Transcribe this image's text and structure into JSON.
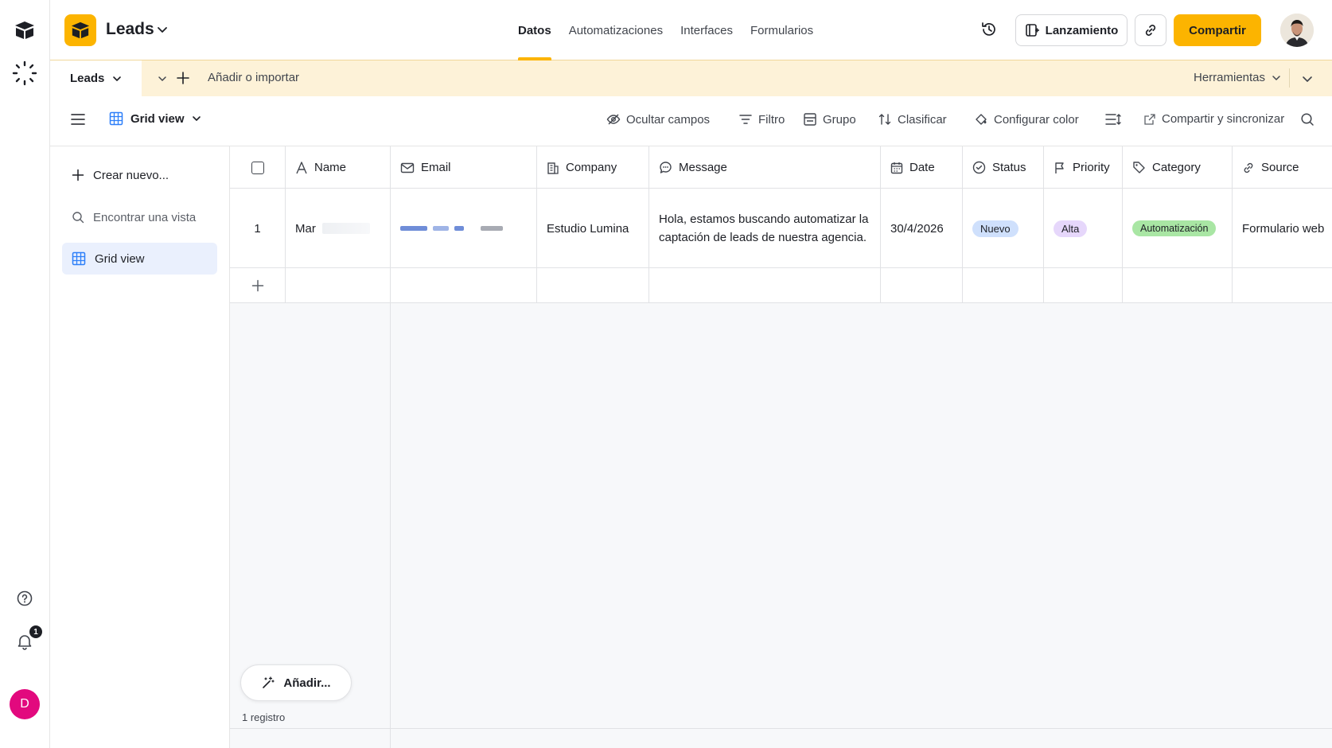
{
  "app": {
    "base_name": "Leads",
    "nav_tabs": [
      "Datos",
      "Automatizaciones",
      "Interfaces",
      "Formularios"
    ],
    "active_nav_tab": "Datos",
    "launch_label": "Lanzamiento",
    "share_label": "Compartir",
    "brand_color": "#fcb400"
  },
  "rail": {
    "user_initial": "D",
    "notification_count": "1",
    "avatar_color": "#e2097e"
  },
  "tables": {
    "active_table": "Leads",
    "add_import_label": "Añadir o importar",
    "tools_label": "Herramientas"
  },
  "viewbar": {
    "view_name": "Grid view",
    "hide_fields": "Ocultar campos",
    "filter": "Filtro",
    "group": "Grupo",
    "sort": "Clasificar",
    "color": "Configurar color",
    "share_sync": "Compartir y sincronizar"
  },
  "views_panel": {
    "create_new": "Crear nuevo...",
    "find_view": "Encontrar una vista",
    "views": [
      "Grid view"
    ]
  },
  "grid": {
    "columns": [
      "Name",
      "Email",
      "Company",
      "Message",
      "Date",
      "Status",
      "Priority",
      "Category",
      "Source"
    ],
    "rows": [
      {
        "row_number": "1",
        "name": "Mar",
        "email": "",
        "company": "Estudio Lumina",
        "message": "Hola, estamos buscando automatizar la captación de leads de nuestra agencia.",
        "date": "30/4/2026",
        "status": "Nuevo",
        "priority": "Alta",
        "category": "Automatización",
        "source": "Formulario web"
      }
    ],
    "add_label": "Añadir...",
    "record_count": "1 registro"
  },
  "pill_colors": {
    "status": "#cfe0fc",
    "priority": "#e6d7fb",
    "category": "#a9e6a4"
  }
}
